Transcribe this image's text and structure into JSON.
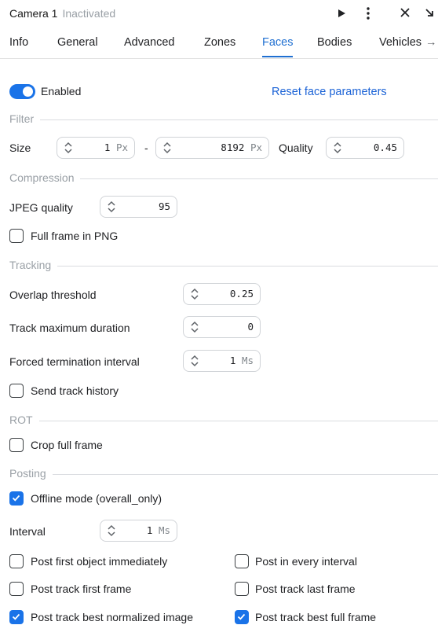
{
  "header": {
    "title": "Camera 1",
    "status": "Inactivated",
    "play_icon": "play-icon",
    "more_icon": "more-vert-icon",
    "close_icon": "close-icon",
    "collapse_icon": "collapse-icon"
  },
  "tabs": [
    {
      "label": "Info",
      "active": false
    },
    {
      "label": "General",
      "active": false
    },
    {
      "label": "Advanced",
      "active": false
    },
    {
      "label": "Zones",
      "active": false
    },
    {
      "label": "Faces",
      "active": true
    },
    {
      "label": "Bodies",
      "active": false
    },
    {
      "label": "Vehicles",
      "active": false
    }
  ],
  "enabled": {
    "label": "Enabled",
    "on": true
  },
  "reset_label": "Reset face parameters",
  "filter": {
    "section": "Filter",
    "size_label": "Size",
    "size_min": {
      "value": "1",
      "unit": "Px"
    },
    "dash": "-",
    "size_max": {
      "value": "8192",
      "unit": "Px"
    },
    "quality_label": "Quality",
    "quality": {
      "value": "0.45"
    }
  },
  "compression": {
    "section": "Compression",
    "jpeg_label": "JPEG quality",
    "jpeg_value": "95",
    "png_label": "Full frame in PNG",
    "png_checked": false
  },
  "tracking": {
    "section": "Tracking",
    "overlap_label": "Overlap threshold",
    "overlap_value": "0.25",
    "duration_label": "Track maximum duration",
    "duration_value": "0",
    "forced_label": "Forced termination interval",
    "forced_value": "1",
    "forced_unit": "Ms",
    "history_label": "Send track history",
    "history_checked": false
  },
  "rot": {
    "section": "ROT",
    "crop_label": "Crop full frame",
    "crop_checked": false
  },
  "posting": {
    "section": "Posting",
    "offline_label": "Offline mode (overall_only)",
    "offline_checked": true,
    "interval_label": "Interval",
    "interval_value": "1",
    "interval_unit": "Ms",
    "options": [
      {
        "label": "Post first object immediately",
        "checked": false
      },
      {
        "label": "Post in every interval",
        "checked": false
      },
      {
        "label": "Post track first frame",
        "checked": false
      },
      {
        "label": "Post track last frame",
        "checked": false
      },
      {
        "label": "Post track best normalized image",
        "checked": true
      },
      {
        "label": "Post track best full frame",
        "checked": true
      }
    ]
  },
  "colors": {
    "accent": "#1a73e8",
    "link": "#1a62d6"
  }
}
